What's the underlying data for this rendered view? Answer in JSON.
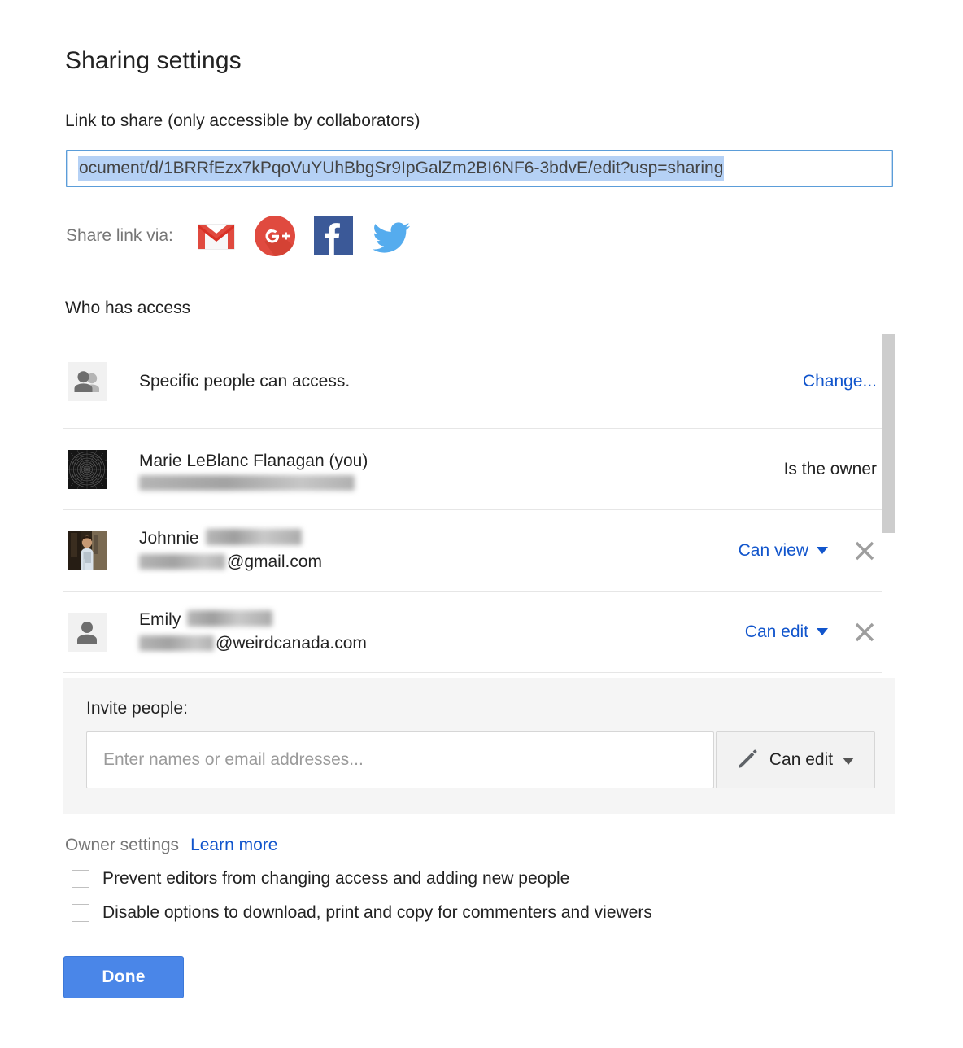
{
  "dialog": {
    "title": "Sharing settings",
    "done_label": "Done"
  },
  "link_section": {
    "label": "Link to share (only accessible by collaborators)",
    "url": "ocument/d/1BRRfEzx7kPqoVuYUhBbgSr9IpGalZm2BI6NF6-3bdvE/edit?usp=sharing",
    "share_via_label": "Share link via:",
    "social_icons": [
      {
        "name": "gmail-icon",
        "label": "Gmail"
      },
      {
        "name": "google-plus-icon",
        "label": "Google+"
      },
      {
        "name": "facebook-icon",
        "label": "Facebook"
      },
      {
        "name": "twitter-icon",
        "label": "Twitter"
      }
    ]
  },
  "access_section": {
    "heading": "Who has access",
    "visibility_row": {
      "icon": "people-group-icon",
      "text": "Specific people can access.",
      "action_label": "Change..."
    },
    "people": [
      {
        "avatar": "moire-pattern-avatar",
        "name": "Marie LeBlanc Flanagan (you)",
        "email_visible": "",
        "email_redacted": true,
        "role": "Is the owner",
        "role_interactive": false,
        "removable": false
      },
      {
        "avatar": "photo-avatar",
        "name": "Johnnie",
        "name_redacted": true,
        "email_visible": "@gmail.com",
        "email_redacted": true,
        "role": "Can view",
        "role_interactive": true,
        "removable": true
      },
      {
        "avatar": "person-placeholder-avatar",
        "name": "Emily",
        "name_redacted": true,
        "email_visible": "@weirdcanada.com",
        "email_redacted": true,
        "role": "Can edit",
        "role_interactive": true,
        "removable": true
      }
    ]
  },
  "invite_section": {
    "label": "Invite people:",
    "input_value": "",
    "input_placeholder": "Enter names or email addresses...",
    "role_button_label": "Can edit",
    "role_button_icon": "pencil-icon"
  },
  "owner_settings": {
    "label": "Owner settings",
    "learn_more_label": "Learn more",
    "checkboxes": [
      {
        "label": "Prevent editors from changing access and adding new people",
        "checked": false
      },
      {
        "label": "Disable options to download, print and copy for commenters and viewers",
        "checked": false
      }
    ]
  },
  "colors": {
    "link_blue": "#1155cc",
    "button_blue": "#4a86e8",
    "selection_blue": "#b5d1f5",
    "panel_gray": "#f5f5f5",
    "muted_text": "#777777"
  }
}
